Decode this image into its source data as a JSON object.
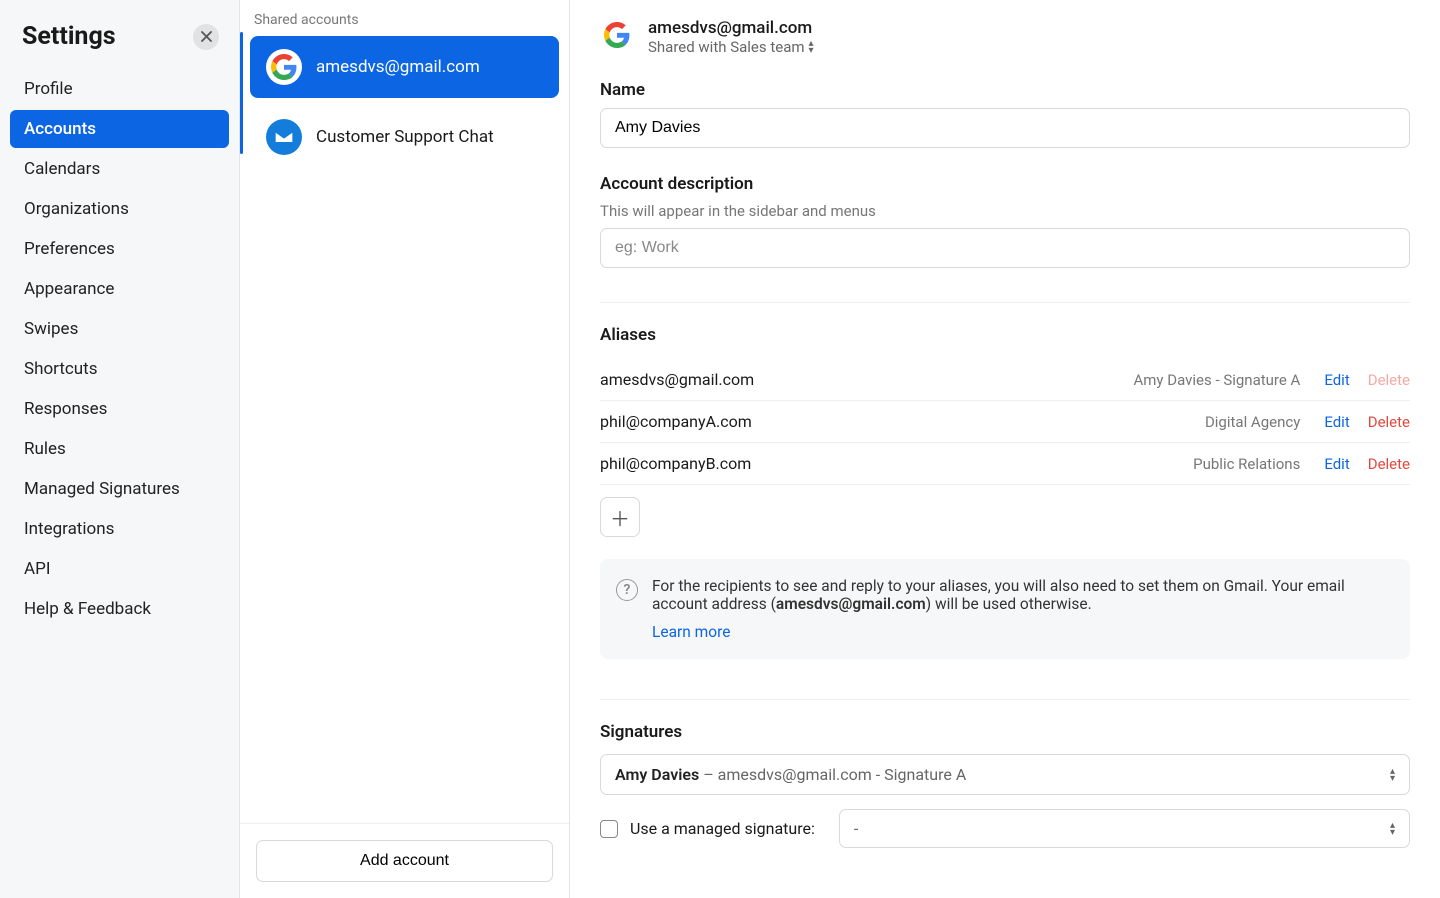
{
  "sidebar": {
    "title": "Settings",
    "items": [
      {
        "label": "Profile"
      },
      {
        "label": "Accounts"
      },
      {
        "label": "Calendars"
      },
      {
        "label": "Organizations"
      },
      {
        "label": "Preferences"
      },
      {
        "label": "Appearance"
      },
      {
        "label": "Swipes"
      },
      {
        "label": "Shortcuts"
      },
      {
        "label": "Responses"
      },
      {
        "label": "Rules"
      },
      {
        "label": "Managed Signatures"
      },
      {
        "label": "Integrations"
      },
      {
        "label": "API"
      },
      {
        "label": "Help & Feedback"
      }
    ],
    "active_index": 1
  },
  "accounts_column": {
    "header": "Shared accounts",
    "items": [
      {
        "label": "amesdvs@gmail.com",
        "icon": "google"
      },
      {
        "label": "Customer Support Chat",
        "icon": "chat"
      }
    ],
    "selected_index": 0,
    "add_button": "Add account"
  },
  "main": {
    "account_email": "amesdvs@gmail.com",
    "shared_with": "Shared with Sales team",
    "name_label": "Name",
    "name_value": "Amy Davies",
    "desc_label": "Account description",
    "desc_sub": "This will appear in the sidebar and menus",
    "desc_placeholder": "eg: Work",
    "aliases_label": "Aliases",
    "aliases": [
      {
        "email": "amesdvs@gmail.com",
        "name": "Amy Davies - Signature A",
        "edit": "Edit",
        "delete": "Delete",
        "delete_dim": true
      },
      {
        "email": "phil@companyA.com",
        "name": "Digital Agency",
        "edit": "Edit",
        "delete": "Delete",
        "delete_dim": false
      },
      {
        "email": "phil@companyB.com",
        "name": "Public Relations",
        "edit": "Edit",
        "delete": "Delete",
        "delete_dim": false
      }
    ],
    "info_text_pre": "For the recipients to see and reply to your aliases, you will also need to set them on Gmail. Your email account address (",
    "info_text_bold": "amesdvs@gmail.com",
    "info_text_post": ") will be used otherwise.",
    "learn_more": "Learn more",
    "signatures_label": "Signatures",
    "sig_select_bold": "Amy Davies",
    "sig_select_rest": " – amesdvs@gmail.com - Signature A",
    "managed_label": "Use a managed signature:",
    "managed_value": "-"
  }
}
